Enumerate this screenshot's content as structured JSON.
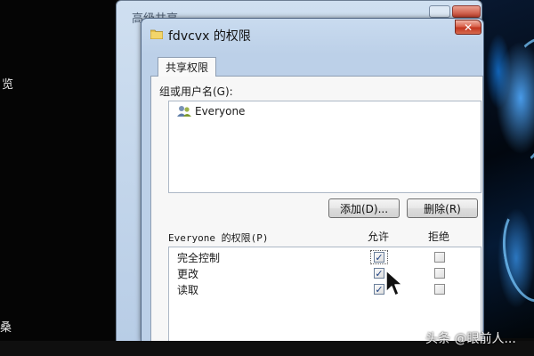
{
  "background": {
    "left_texts": [
      "览",
      "桑"
    ]
  },
  "back_window": {
    "title": "高级共享"
  },
  "dialog": {
    "title": "fdvcvx 的权限",
    "close_glyph": "✕",
    "tab_label": "共享权限",
    "group_label": "组或用户名(G):",
    "users": [
      "Everyone"
    ],
    "add_button": "添加(D)...",
    "remove_button": "删除(R)",
    "permissions_header": "Everyone 的权限(P)",
    "allow_header": "允许",
    "deny_header": "拒绝",
    "permissions": [
      {
        "name": "完全控制",
        "allow": true,
        "deny": false
      },
      {
        "name": "更改",
        "allow": true,
        "deny": false
      },
      {
        "name": "读取",
        "allow": true,
        "deny": false
      }
    ]
  },
  "watermark": "头条 @眼前人..."
}
